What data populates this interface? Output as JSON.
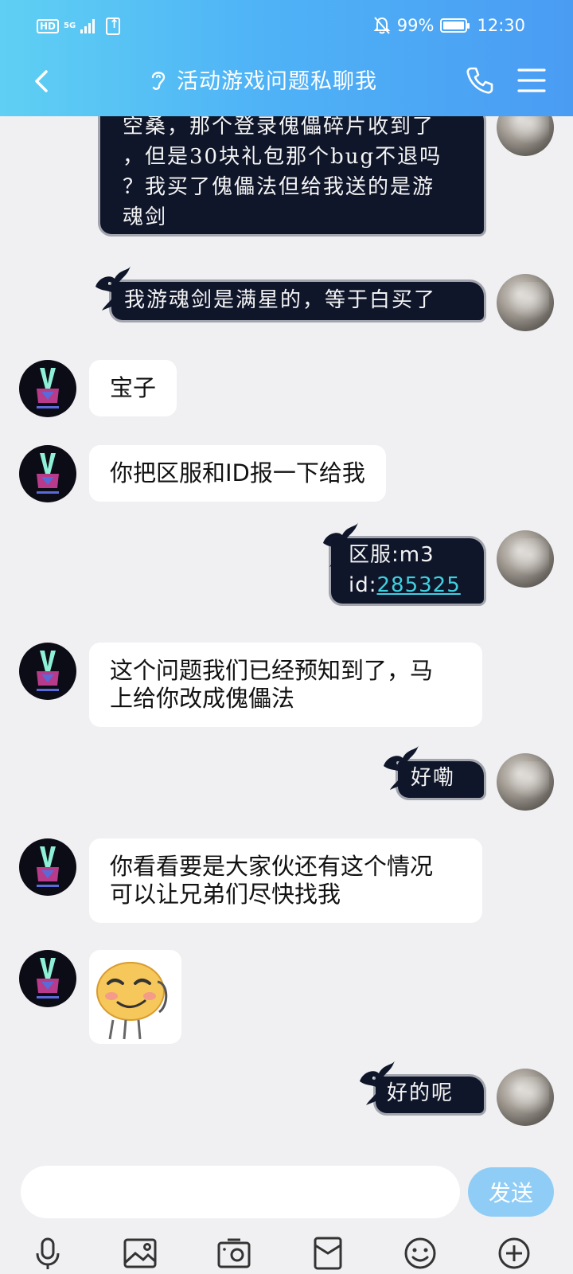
{
  "status_bar": {
    "hd": "HD",
    "network": "5G",
    "battery": "99%",
    "time": "12:30"
  },
  "header": {
    "title": "活动游戏问题私聊我"
  },
  "messages": [
    {
      "from": "self",
      "style": "ink",
      "lines": [
        "空桑，那个登录傀儡碎片收到了",
        "，但是30块礼包那个bug不退吗",
        "？我买了傀儡法但给我送的是游",
        "魂剑"
      ]
    },
    {
      "from": "self",
      "style": "ink",
      "lines": [
        "我游魂剑是满星的，等于白买了"
      ]
    },
    {
      "from": "other",
      "style": "white",
      "text": "宝子"
    },
    {
      "from": "other",
      "style": "white",
      "text": "你把区服和ID报一下给我"
    },
    {
      "from": "self",
      "style": "ink",
      "line1": "区服:m3",
      "line2_prefix": "id:",
      "id_value": "285325"
    },
    {
      "from": "other",
      "style": "white",
      "line1": "这个问题我们已经预知到了，马",
      "line2": "上给你改成傀儡法"
    },
    {
      "from": "self",
      "style": "ink",
      "text": "好嘞"
    },
    {
      "from": "other",
      "style": "white",
      "line1": "你看看要是大家伙还有这个情况",
      "line2": "可以让兄弟们尽快找我"
    },
    {
      "from": "other",
      "style": "sticker",
      "sticker": "smirk-emoji-sticker"
    },
    {
      "from": "self",
      "style": "ink",
      "text": "好的呢"
    }
  ],
  "input": {
    "value": "",
    "placeholder": "",
    "send_label": "发送"
  },
  "toolbar": {
    "icons": [
      "microphone-icon",
      "image-icon",
      "camera-icon",
      "red-packet-icon",
      "emoji-icon",
      "plus-icon"
    ]
  },
  "colors": {
    "header_start": "#5fd0f3",
    "header_end": "#4a9cf3",
    "send_button": "#8fcdf6",
    "chat_bg": "#f0f0f2",
    "ink_bubble": "#10162a",
    "id_link": "#3fd0e0"
  }
}
